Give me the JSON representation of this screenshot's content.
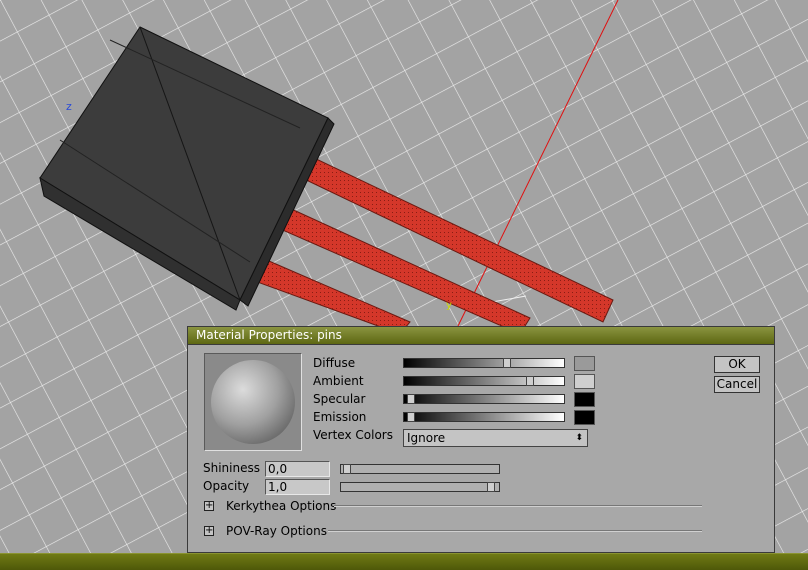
{
  "viewport": {
    "axis_z": "z",
    "axis_y": "y"
  },
  "dialog": {
    "title": "Material Properties: pins",
    "ok_label": "OK",
    "cancel_label": "Cancel",
    "color_rows": [
      {
        "label": "Diffuse",
        "level": 0.65,
        "swatch": "#9a9a9a"
      },
      {
        "label": "Ambient",
        "level": 0.8,
        "swatch": "#cfcfcf"
      },
      {
        "label": "Specular",
        "level": 0.02,
        "swatch": "#000000"
      },
      {
        "label": "Emission",
        "level": 0.02,
        "swatch": "#000000"
      }
    ],
    "vertex_colors_label": "Vertex Colors",
    "vertex_colors_value": "Ignore",
    "shininess_label": "Shininess",
    "shininess_value": "0,0",
    "shininess_level": 0.0,
    "opacity_label": "Opacity",
    "opacity_value": "1,0",
    "opacity_level": 1.0,
    "sections": [
      "Kerkythea Options",
      "POV-Ray Options"
    ]
  },
  "colors": {
    "titlebar": "#6f7a1f",
    "pins": "#d23a2a",
    "body": "#3a3a3a"
  }
}
